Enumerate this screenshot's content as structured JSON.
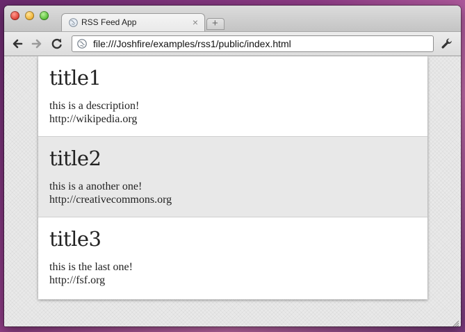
{
  "browser": {
    "tab_title": "RSS Feed App",
    "tab_close": "×",
    "new_tab": "+",
    "url": "file:///Joshfire/examples/rss1/public/index.html"
  },
  "feed": {
    "items": [
      {
        "title": "title1",
        "description": "this is a description!",
        "link": "http://wikipedia.org"
      },
      {
        "title": "title2",
        "description": "this is a another one!",
        "link": "http://creativecommons.org"
      },
      {
        "title": "title3",
        "description": "this is the last one!",
        "link": "http://fsf.org"
      }
    ]
  },
  "icons": {
    "back": "back-arrow-icon",
    "forward": "forward-arrow-icon",
    "reload": "reload-icon",
    "page": "page-globe-icon",
    "wrench": "wrench-icon"
  }
}
